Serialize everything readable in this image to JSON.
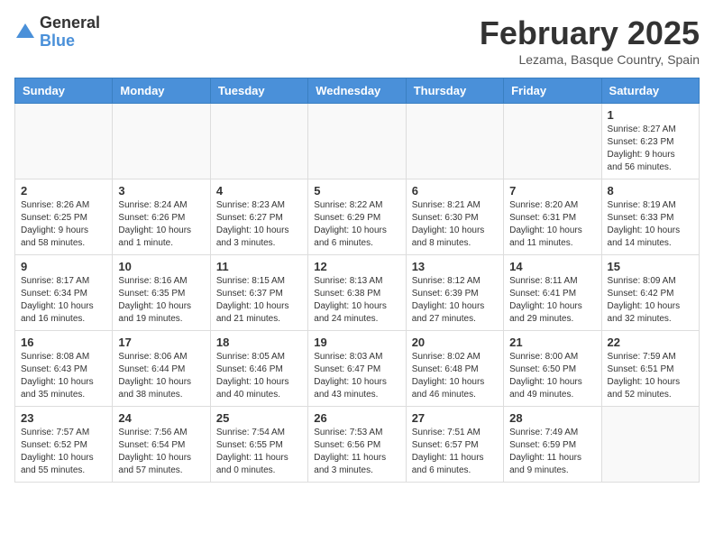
{
  "logo": {
    "general": "General",
    "blue": "Blue"
  },
  "header": {
    "month": "February 2025",
    "location": "Lezama, Basque Country, Spain"
  },
  "weekdays": [
    "Sunday",
    "Monday",
    "Tuesday",
    "Wednesday",
    "Thursday",
    "Friday",
    "Saturday"
  ],
  "weeks": [
    [
      {
        "day": "",
        "info": ""
      },
      {
        "day": "",
        "info": ""
      },
      {
        "day": "",
        "info": ""
      },
      {
        "day": "",
        "info": ""
      },
      {
        "day": "",
        "info": ""
      },
      {
        "day": "",
        "info": ""
      },
      {
        "day": "1",
        "info": "Sunrise: 8:27 AM\nSunset: 6:23 PM\nDaylight: 9 hours\nand 56 minutes."
      }
    ],
    [
      {
        "day": "2",
        "info": "Sunrise: 8:26 AM\nSunset: 6:25 PM\nDaylight: 9 hours\nand 58 minutes."
      },
      {
        "day": "3",
        "info": "Sunrise: 8:24 AM\nSunset: 6:26 PM\nDaylight: 10 hours\nand 1 minute."
      },
      {
        "day": "4",
        "info": "Sunrise: 8:23 AM\nSunset: 6:27 PM\nDaylight: 10 hours\nand 3 minutes."
      },
      {
        "day": "5",
        "info": "Sunrise: 8:22 AM\nSunset: 6:29 PM\nDaylight: 10 hours\nand 6 minutes."
      },
      {
        "day": "6",
        "info": "Sunrise: 8:21 AM\nSunset: 6:30 PM\nDaylight: 10 hours\nand 8 minutes."
      },
      {
        "day": "7",
        "info": "Sunrise: 8:20 AM\nSunset: 6:31 PM\nDaylight: 10 hours\nand 11 minutes."
      },
      {
        "day": "8",
        "info": "Sunrise: 8:19 AM\nSunset: 6:33 PM\nDaylight: 10 hours\nand 14 minutes."
      }
    ],
    [
      {
        "day": "9",
        "info": "Sunrise: 8:17 AM\nSunset: 6:34 PM\nDaylight: 10 hours\nand 16 minutes."
      },
      {
        "day": "10",
        "info": "Sunrise: 8:16 AM\nSunset: 6:35 PM\nDaylight: 10 hours\nand 19 minutes."
      },
      {
        "day": "11",
        "info": "Sunrise: 8:15 AM\nSunset: 6:37 PM\nDaylight: 10 hours\nand 21 minutes."
      },
      {
        "day": "12",
        "info": "Sunrise: 8:13 AM\nSunset: 6:38 PM\nDaylight: 10 hours\nand 24 minutes."
      },
      {
        "day": "13",
        "info": "Sunrise: 8:12 AM\nSunset: 6:39 PM\nDaylight: 10 hours\nand 27 minutes."
      },
      {
        "day": "14",
        "info": "Sunrise: 8:11 AM\nSunset: 6:41 PM\nDaylight: 10 hours\nand 29 minutes."
      },
      {
        "day": "15",
        "info": "Sunrise: 8:09 AM\nSunset: 6:42 PM\nDaylight: 10 hours\nand 32 minutes."
      }
    ],
    [
      {
        "day": "16",
        "info": "Sunrise: 8:08 AM\nSunset: 6:43 PM\nDaylight: 10 hours\nand 35 minutes."
      },
      {
        "day": "17",
        "info": "Sunrise: 8:06 AM\nSunset: 6:44 PM\nDaylight: 10 hours\nand 38 minutes."
      },
      {
        "day": "18",
        "info": "Sunrise: 8:05 AM\nSunset: 6:46 PM\nDaylight: 10 hours\nand 40 minutes."
      },
      {
        "day": "19",
        "info": "Sunrise: 8:03 AM\nSunset: 6:47 PM\nDaylight: 10 hours\nand 43 minutes."
      },
      {
        "day": "20",
        "info": "Sunrise: 8:02 AM\nSunset: 6:48 PM\nDaylight: 10 hours\nand 46 minutes."
      },
      {
        "day": "21",
        "info": "Sunrise: 8:00 AM\nSunset: 6:50 PM\nDaylight: 10 hours\nand 49 minutes."
      },
      {
        "day": "22",
        "info": "Sunrise: 7:59 AM\nSunset: 6:51 PM\nDaylight: 10 hours\nand 52 minutes."
      }
    ],
    [
      {
        "day": "23",
        "info": "Sunrise: 7:57 AM\nSunset: 6:52 PM\nDaylight: 10 hours\nand 55 minutes."
      },
      {
        "day": "24",
        "info": "Sunrise: 7:56 AM\nSunset: 6:54 PM\nDaylight: 10 hours\nand 57 minutes."
      },
      {
        "day": "25",
        "info": "Sunrise: 7:54 AM\nSunset: 6:55 PM\nDaylight: 11 hours\nand 0 minutes."
      },
      {
        "day": "26",
        "info": "Sunrise: 7:53 AM\nSunset: 6:56 PM\nDaylight: 11 hours\nand 3 minutes."
      },
      {
        "day": "27",
        "info": "Sunrise: 7:51 AM\nSunset: 6:57 PM\nDaylight: 11 hours\nand 6 minutes."
      },
      {
        "day": "28",
        "info": "Sunrise: 7:49 AM\nSunset: 6:59 PM\nDaylight: 11 hours\nand 9 minutes."
      },
      {
        "day": "",
        "info": ""
      }
    ]
  ]
}
